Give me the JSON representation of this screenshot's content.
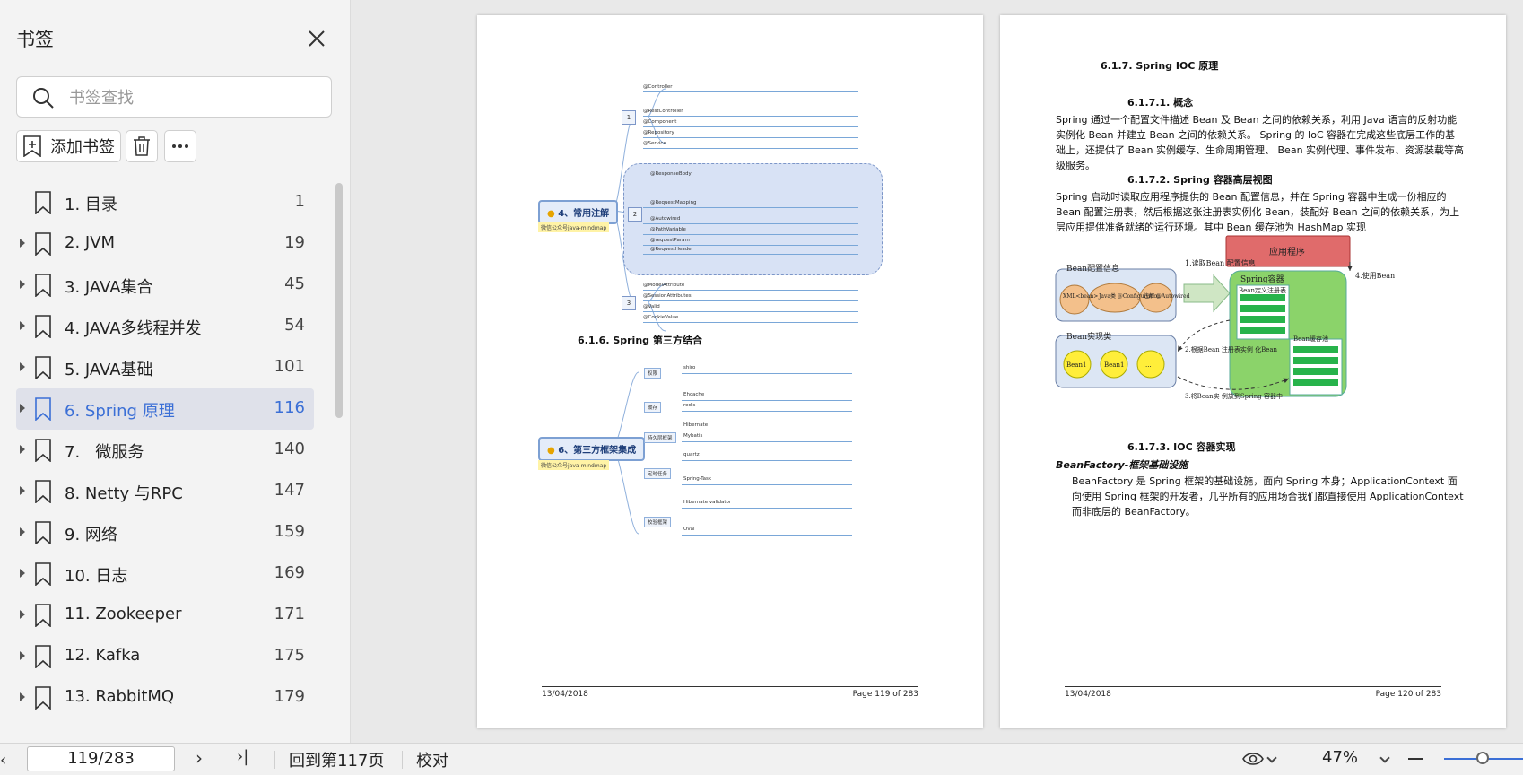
{
  "sidebar": {
    "title": "书签",
    "search_placeholder": "书签查找",
    "add_bookmark_label": "添加书签",
    "items": [
      {
        "label": "1. 目录",
        "page": "1",
        "expandable": false,
        "active": false
      },
      {
        "label": "2. JVM",
        "page": "19",
        "expandable": true,
        "active": false
      },
      {
        "label": "3. JAVA集合",
        "page": "45",
        "expandable": true,
        "active": false
      },
      {
        "label": "4. JAVA多线程并发",
        "page": "54",
        "expandable": true,
        "active": false
      },
      {
        "label": "5. JAVA基础",
        "page": "101",
        "expandable": true,
        "active": false
      },
      {
        "label": "6. Spring 原理",
        "page": "116",
        "expandable": true,
        "active": true
      },
      {
        "label": "7.   微服务",
        "page": "140",
        "expandable": true,
        "active": false
      },
      {
        "label": "8. Netty 与RPC",
        "page": "147",
        "expandable": true,
        "active": false
      },
      {
        "label": "9. 网络",
        "page": "159",
        "expandable": true,
        "active": false
      },
      {
        "label": "10. 日志",
        "page": "169",
        "expandable": true,
        "active": false
      },
      {
        "label": "11. Zookeeper",
        "page": "171",
        "expandable": true,
        "active": false
      },
      {
        "label": "12. Kafka",
        "page": "175",
        "expandable": true,
        "active": false
      },
      {
        "label": "13. RabbitMQ",
        "page": "179",
        "expandable": true,
        "active": false
      }
    ]
  },
  "page_left": {
    "section_title": "6.1.6. Spring 第三方结合",
    "node1": "4、常用注解",
    "node2": "6、第三方框架集成",
    "node_sub": "微信公众号java-mindmap",
    "branches1": [
      "@Controller",
      "@RestController",
      "@Component",
      "@Repository",
      "@Service",
      "@ResponseBody",
      "@RequestMapping",
      "@Autowired",
      "@PathVariable",
      "@requestParam",
      "@RequestHeader",
      "@ModelAttribute",
      "@SessionAttributes",
      "@Valid",
      "@CookieValue"
    ],
    "branches2": [
      "权限",
      "缓存",
      "持久层框架",
      "定时任务",
      "校验框架"
    ],
    "leaves2": [
      "shiro",
      "Ehcache",
      "redis",
      "Hibernate",
      "Mybatis",
      "quartz",
      "Spring-Task",
      "Hibernate validator",
      "Oval"
    ],
    "footer_date": "13/04/2018",
    "footer_page": "Page 119 of 283"
  },
  "page_right": {
    "h1": "6.1.7. Spring IOC 原理",
    "h2": "6.1.7.1.     概念",
    "p1": "Spring 通过一个配置文件描述 Bean 及 Bean 之间的依赖关系，利用 Java 语言的反射功能实例化 Bean 并建立 Bean 之间的依赖关系。 Spring 的 IoC 容器在完成这些底层工作的基础上，还提供了 Bean 实例缓存、生命周期管理、 Bean 实例代理、事件发布、资源装载等高级服务。",
    "h3": "6.1.7.2.     Spring 容器高层视图",
    "p2": "Spring 启动时读取应用程序提供的 Bean 配置信息，并在 Spring 容器中生成一份相应的 Bean 配置注册表，然后根据这张注册表实例化 Bean，装配好 Bean 之间的依赖关系，为上层应用提供准备就绪的运行环境。其中 Bean 缓存池为 HashMap 实现",
    "diagram": {
      "app": "应用程序",
      "bean_config": "Bean配置信息",
      "xml": "XML<bean>",
      "javaclass": "Java类 @Configuration",
      "annotation": "注解 @Autowired",
      "step1": "1.读取Bean 配置信息",
      "container": "Spring容器",
      "registry": "Bean定义注册表",
      "step2": "2.根据Bean 注册表实例 化Bean",
      "impl": "Bean实现类",
      "bean": "Bean1",
      "dots": "...",
      "cache": "Bean缓存池",
      "step3": "3.将Bean实 例放到Spring 容器中",
      "step4": "4.使用Bean"
    },
    "h4": "6.1.7.3.     IOC 容器实现",
    "h5": "BeanFactory-框架基础设施",
    "p3": "BeanFactory 是 Spring 框架的基础设施，面向 Spring 本身；ApplicationContext 面向使用 Spring 框架的开发者，几乎所有的应用场合我们都直接使用 ApplicationContext 而非底层的 BeanFactory。",
    "footer_date": "13/04/2018",
    "footer_page": "Page 120 of 283"
  },
  "bottombar": {
    "page_input": "119/283",
    "back_label": "回到第117页",
    "proofread_label": "校对",
    "zoom": "47%"
  },
  "colors": {
    "accent": "#3b6fd6",
    "active_bg": "#dfe1ea"
  }
}
